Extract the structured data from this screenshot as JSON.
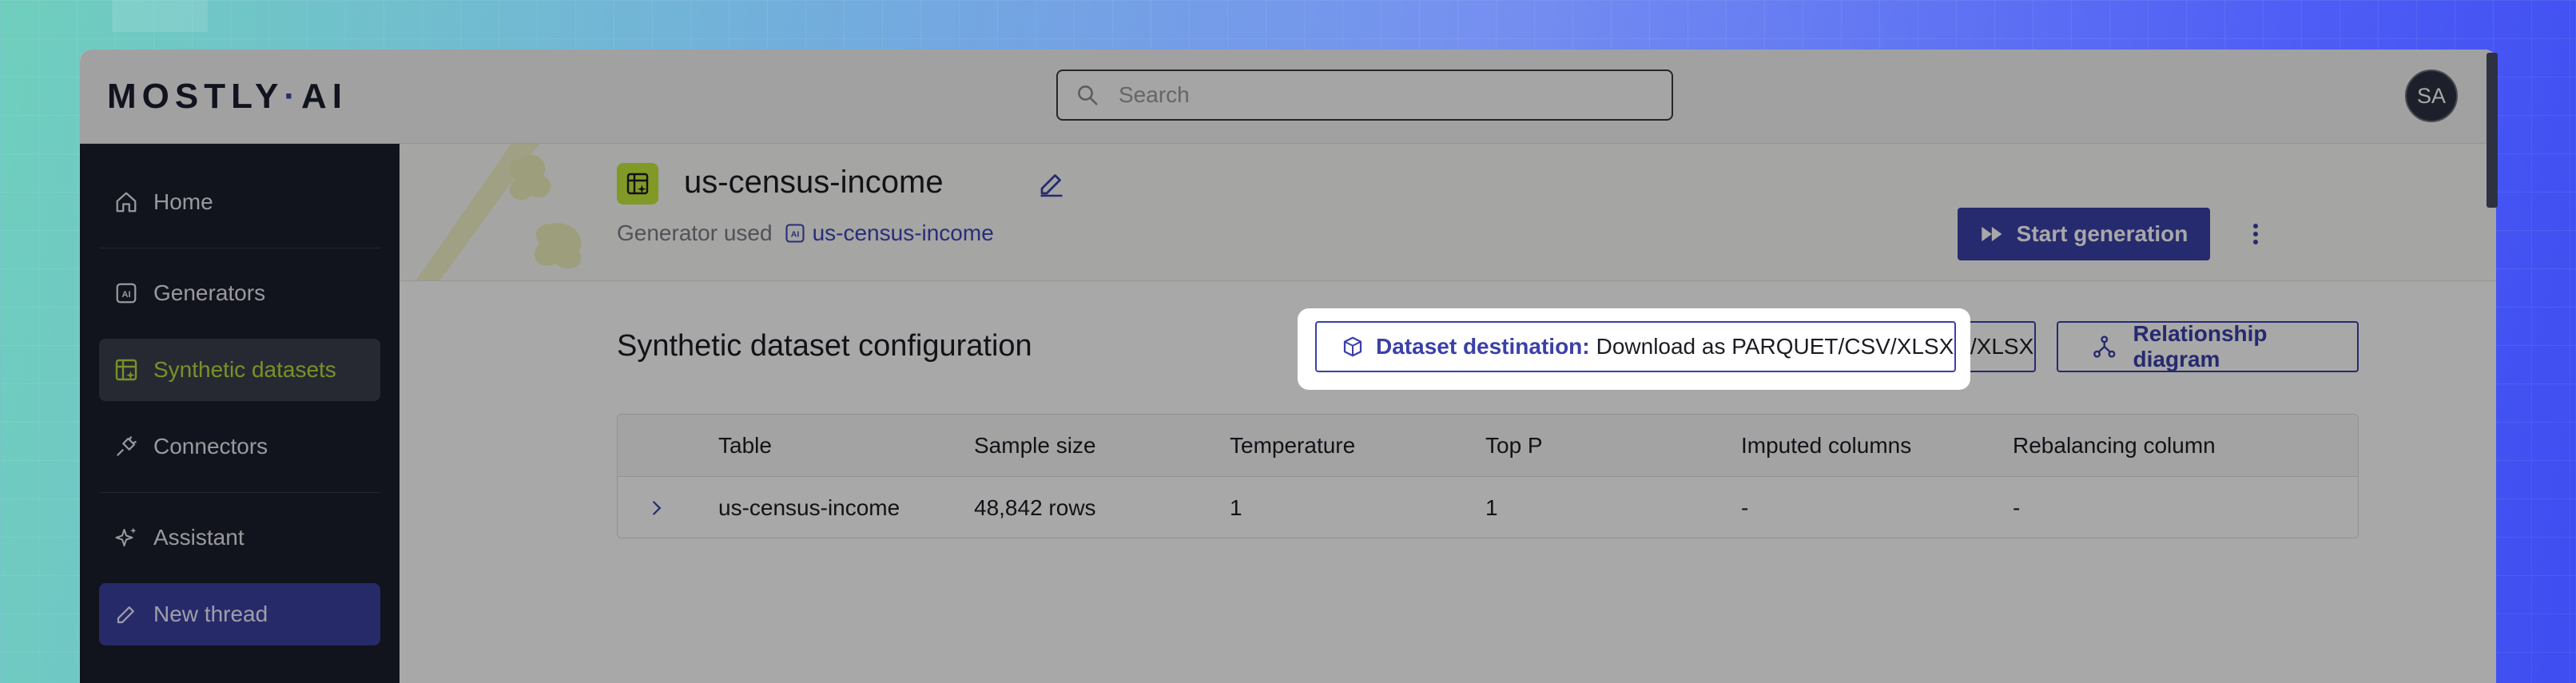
{
  "app": {
    "logo_left": "MOSTLY",
    "logo_dot": "·",
    "logo_right": "AI",
    "search_placeholder": "Search",
    "avatar_initials": "SA"
  },
  "sidebar": {
    "items": [
      {
        "label": "Home",
        "icon": "home-icon"
      },
      {
        "label": "Generators",
        "icon": "ai-chip-icon"
      },
      {
        "label": "Synthetic datasets",
        "icon": "table-sparkle-icon",
        "active": true
      },
      {
        "label": "Connectors",
        "icon": "plug-icon"
      },
      {
        "label": "Assistant",
        "icon": "sparkle-icon"
      },
      {
        "label": "New thread",
        "icon": "pencil-icon",
        "active": true
      }
    ]
  },
  "dataset": {
    "title": "us-census-income",
    "generator_used_label": "Generator used",
    "generator_name": "us-census-income"
  },
  "actions": {
    "start_generation": "Start generation"
  },
  "config": {
    "section_title": "Synthetic dataset configuration",
    "destination_label": "Dataset destination:",
    "destination_value": "Download as PARQUET/CSV/XLSX",
    "relationship_diagram": "Relationship diagram"
  },
  "table": {
    "columns": [
      "Table",
      "Sample size",
      "Temperature",
      "Top P",
      "Imputed columns",
      "Rebalancing column"
    ],
    "rows": [
      [
        "us-census-income",
        "48,842 rows",
        "1",
        "1",
        "-",
        "-"
      ]
    ]
  },
  "colors": {
    "accent": "#3a40a8",
    "lime": "#c4e83c",
    "sidebar_bg": "#1a1e2c"
  }
}
